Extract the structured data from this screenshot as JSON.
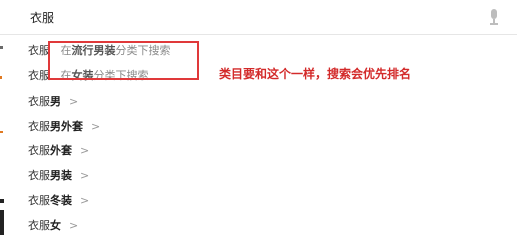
{
  "search": {
    "query": "衣服"
  },
  "suggestions": {
    "scoped": [
      {
        "prefix": "衣服",
        "cat_pre": "在",
        "cat_bold": "流行男装",
        "cat_post": "分类下搜索"
      },
      {
        "prefix": "衣服",
        "cat_pre": "在",
        "cat_bold": "女装",
        "cat_post": "分类下搜索"
      }
    ],
    "items": [
      {
        "base": "衣服",
        "bold": "男",
        "chevron": ">"
      },
      {
        "base": "衣服",
        "bold": "男外套",
        "chevron": ">"
      },
      {
        "base": "衣服",
        "bold": "外套",
        "chevron": ">"
      },
      {
        "base": "衣服",
        "bold": "男装",
        "chevron": ">"
      },
      {
        "base": "衣服",
        "bold": "冬装",
        "chevron": ">"
      },
      {
        "base": "衣服",
        "bold": "女",
        "chevron": ">"
      }
    ]
  },
  "annotation": {
    "text": "类目要和这个一样，搜索会优先排名"
  },
  "colors": {
    "accent_red": "#d32a2a",
    "box_red": "#e0393a"
  },
  "icons": {
    "mic": "microphone-icon"
  }
}
